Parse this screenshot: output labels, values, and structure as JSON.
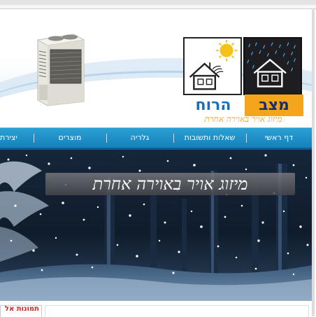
{
  "header": {
    "logo": {
      "word1": "מצב",
      "word2": "הרוח",
      "slogan": "מיזוג אויר באוירה אחרת"
    }
  },
  "nav": {
    "items": [
      {
        "label": "דף ראשי"
      },
      {
        "label": "שאלות ותשובות"
      },
      {
        "label": "גלריה"
      },
      {
        "label": "מוצרים"
      },
      {
        "label": "יצירת"
      }
    ]
  },
  "hero": {
    "caption": "מיזוג אויר באוירה אחרת"
  },
  "footer_tabs": {
    "label": "תמונות אל"
  },
  "colors": {
    "nav_blue": "#1a8bc6",
    "logo_orange": "#f4a51c",
    "logo_blue": "#1c6fb4",
    "accent_red": "#d2231c"
  }
}
